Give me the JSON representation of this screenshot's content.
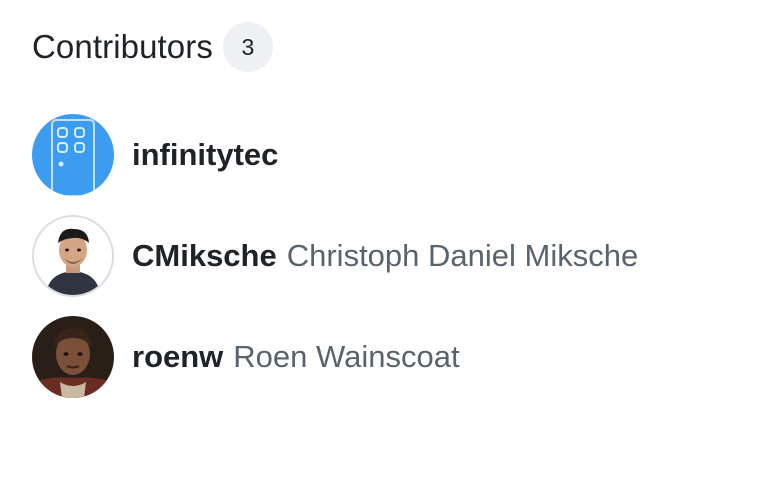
{
  "contributors": {
    "title": "Contributors",
    "count": "3",
    "items": [
      {
        "login": "infinitytec",
        "name": "",
        "avatar": "app-icon-avatar",
        "avatar_color": "#3b9cf0"
      },
      {
        "login": "CMiksche",
        "name": "Christoph Daniel Miksche",
        "avatar": "person-photo-avatar"
      },
      {
        "login": "roenw",
        "name": "Roen Wainscoat",
        "avatar": "person-photo-avatar"
      }
    ]
  },
  "colors": {
    "text": "#1f2328",
    "muted": "#59636e",
    "badge_bg": "#eef0f3"
  }
}
